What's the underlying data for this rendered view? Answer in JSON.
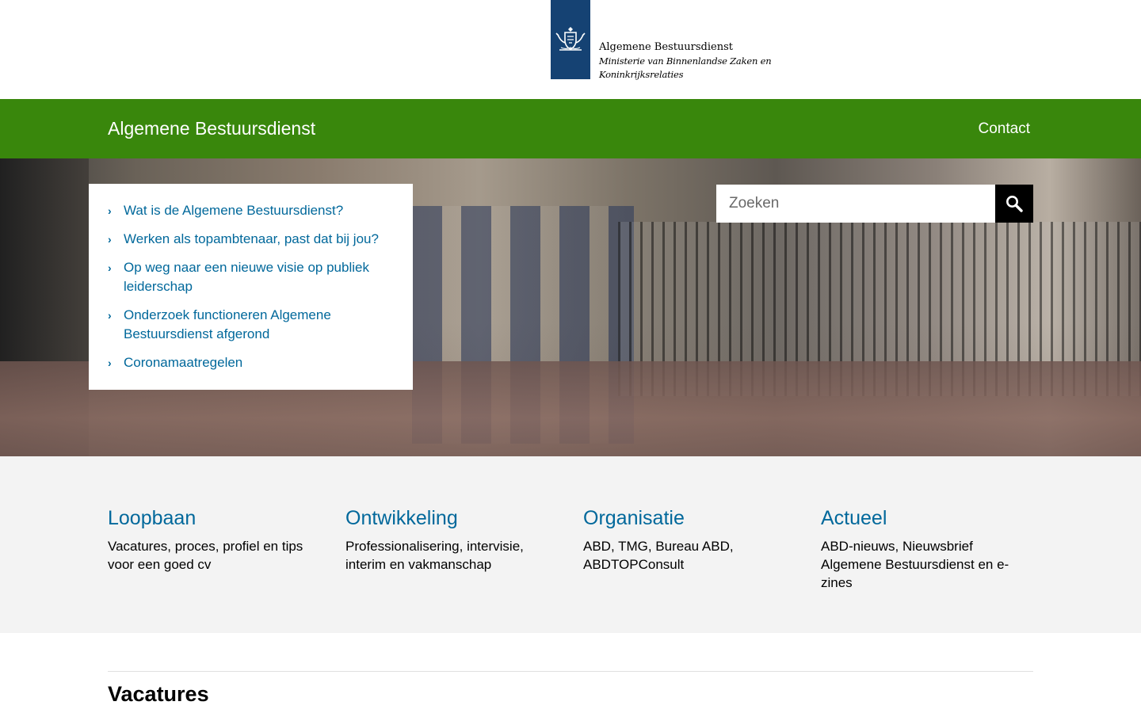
{
  "logo": {
    "organisation": "Algemene Bestuursdienst",
    "ministry_line1": "Ministerie van Binnenlandse Zaken en",
    "ministry_line2": "Koninkrijksrelaties",
    "icon": "coat-of-arms-icon"
  },
  "nav": {
    "site_title": "Algemene Bestuursdienst",
    "contact": "Contact"
  },
  "hero": {
    "quicklinks": [
      {
        "label": "Wat is de Algemene Bestuursdienst?"
      },
      {
        "label": "Werken als topambtenaar, past dat bij jou?"
      },
      {
        "label": "Op weg naar een nieuwe visie op publiek leiderschap"
      },
      {
        "label": "Onderzoek functioneren Algemene Bestuursdienst afgerond"
      },
      {
        "label": "Coronamaatregelen"
      }
    ],
    "search": {
      "placeholder": "Zoeken",
      "value": "",
      "button_icon": "search-icon"
    }
  },
  "categories": [
    {
      "title": "Loopbaan",
      "description": "Vacatures, proces, profiel en tips voor een goed cv"
    },
    {
      "title": "Ontwikkeling",
      "description": "Professionalisering, intervisie, interim en vakmanschap"
    },
    {
      "title": "Organisatie",
      "description": "ABD, TMG, Bureau ABD, ABDTOPConsult"
    },
    {
      "title": "Actueel",
      "description": "ABD-nieuws, Nieuwsbrief Algemene Bestuursdienst en e-zines"
    }
  ],
  "section": {
    "vacatures_heading": "Vacatures"
  },
  "colors": {
    "brand_green": "#39870c",
    "logo_blue": "#154273",
    "link_blue": "#01689b",
    "band_grey": "#f3f3f3"
  }
}
